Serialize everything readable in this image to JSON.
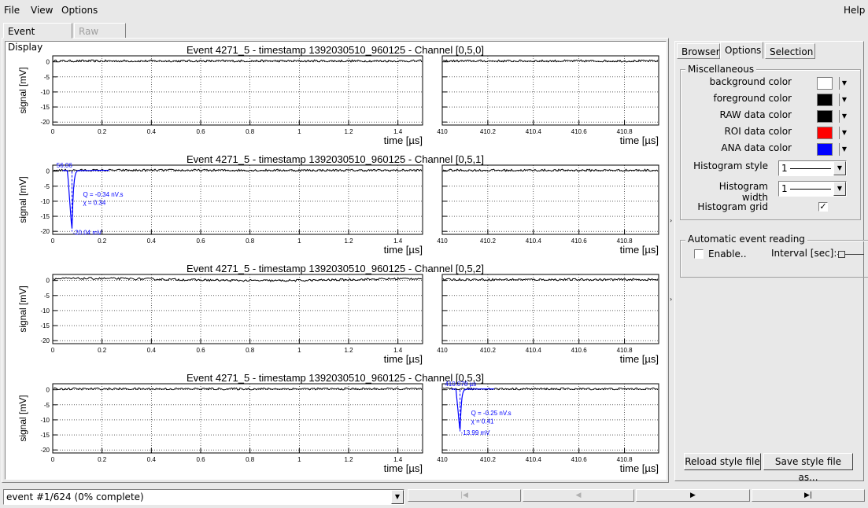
{
  "menubar": {
    "file": "File",
    "view": "View",
    "options": "Options",
    "help": "Help"
  },
  "main_tabs": [
    {
      "label": "Event Display"
    },
    {
      "label": "Raw Data"
    }
  ],
  "right_tabs": [
    {
      "label": "Browser"
    },
    {
      "label": "Options"
    },
    {
      "label": "Selection"
    }
  ],
  "misc": {
    "title": "Miscellaneous",
    "colors": [
      {
        "label": "background color",
        "color": "#ffffff"
      },
      {
        "label": "foreground color",
        "color": "#000000"
      },
      {
        "label": "RAW data color",
        "color": "#000000"
      },
      {
        "label": "ROI data color",
        "color": "#ff0000"
      },
      {
        "label": "ANA data color",
        "color": "#0000ff"
      }
    ],
    "histogram_style_label": "Histogram style",
    "histogram_style_value": "1",
    "histogram_width_label": "Histogram width",
    "histogram_width_value": "1",
    "histogram_grid_label": "Histogram grid",
    "histogram_grid_checked": true
  },
  "auto": {
    "title": "Automatic event reading",
    "enable_label": "Enable..",
    "enable_checked": false,
    "interval_label": "Interval [sec]:"
  },
  "buttons": {
    "reload": "Reload style file",
    "save": "Save style file as..."
  },
  "status": {
    "event_value": "event #1/624 (0% complete)"
  },
  "chart_data": {
    "type": "line",
    "ylabel": "signal [mV]",
    "xlabel": "time [µs]",
    "left_xlim": [
      0,
      1.5
    ],
    "left_ticks": [
      "0",
      "0.2",
      "0.4",
      "0.6",
      "0.8",
      "1",
      "1.2",
      "1.4"
    ],
    "right_xlim": [
      410,
      410.95
    ],
    "right_ticks": [
      "410",
      "410.2",
      "410.4",
      "410.6",
      "410.8"
    ],
    "ylim": [
      -21,
      2
    ],
    "y_ticks": [
      "0",
      "-5",
      "-10",
      "-15",
      "-20"
    ],
    "grid": true,
    "raw_color": "#000000",
    "ana_color": "#0000ff",
    "channels": [
      {
        "title": "Event 4271_5 - timestamp 1392030510_960125 - Channel [0,5,0]"
      },
      {
        "title": "Event 4271_5 - timestamp 1392030510_960125 - Channel [0,5,1]",
        "pulse": {
          "panel": "left",
          "start": 0.06,
          "peak_time": 0.078,
          "peak_value": -20.04,
          "start_label": "56.06",
          "charge_label": "Q = -0.34 nV.s",
          "chi_label": "χ = 0.34",
          "peak_label": "-20.04 mV"
        }
      },
      {
        "title": "Event 4271_5 - timestamp 1392030510_960125 - Channel [0,5,2]"
      },
      {
        "title": "Event 4271_5 - timestamp 1392030510_960125 - Channel [0,5,3]",
        "pulse": {
          "panel": "right",
          "start": 410.06,
          "peak_time": 410.078,
          "peak_value": -13.99,
          "start_label": "410.078 µs",
          "charge_label": "Q = -0.25 nV.s",
          "chi_label": "χ = 0.41",
          "peak_label": "-13.99 mV"
        }
      }
    ]
  }
}
